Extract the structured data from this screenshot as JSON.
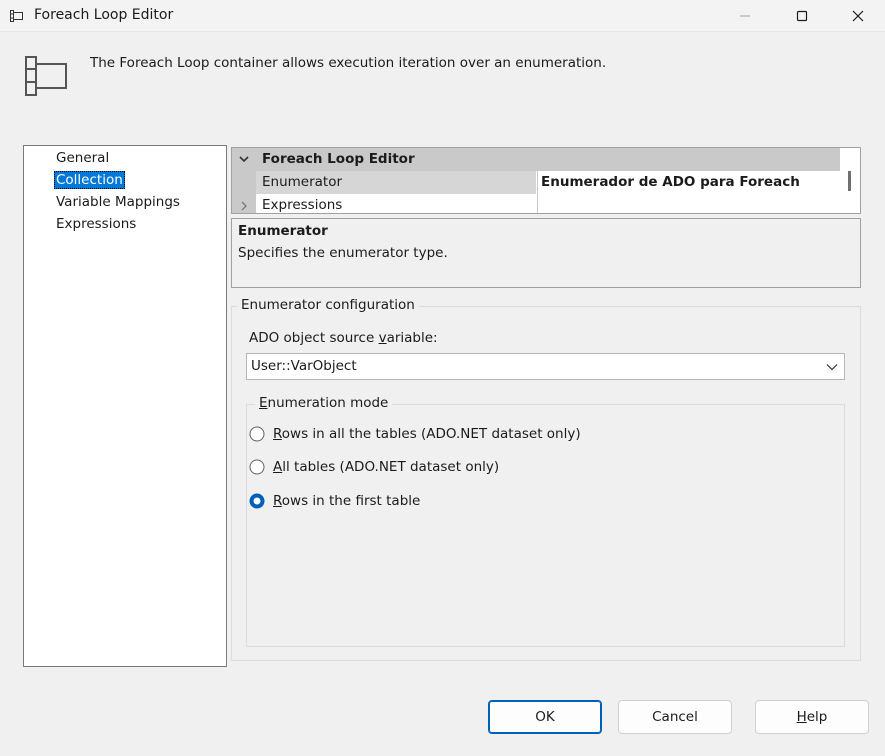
{
  "window": {
    "title": "Foreach Loop Editor",
    "icons": {
      "app": "foreach-container-icon",
      "minimize": "minimize-icon",
      "maximize": "maximize-icon",
      "close": "close-icon"
    }
  },
  "banner": {
    "description": "The Foreach Loop container allows execution iteration over an enumeration."
  },
  "nav": {
    "items": [
      {
        "label": "General"
      },
      {
        "label": "Collection"
      },
      {
        "label": "Variable Mappings"
      },
      {
        "label": "Expressions"
      }
    ],
    "selected": "Collection"
  },
  "property_grid": {
    "category": "Foreach Loop Editor",
    "rows": [
      {
        "name": "Enumerator",
        "value": "Enumerador de ADO para Foreach"
      },
      {
        "name": "Expressions",
        "value": ""
      }
    ]
  },
  "description_panel": {
    "title": "Enumerator",
    "text": "Specifies the enumerator type."
  },
  "enumerator_config": {
    "legend": "Enumerator configuration",
    "source_label_pre": "ADO object source ",
    "source_label_u": "v",
    "source_label_post": "ariable:",
    "source_value": "User::VarObject",
    "mode_group": {
      "legend_u": "E",
      "legend_rest": "numeration mode",
      "options": [
        {
          "u": "R",
          "rest": "ows in all the tables (ADO.NET dataset only)",
          "checked": false
        },
        {
          "u": "A",
          "rest": "ll tables (ADO.NET dataset only)",
          "checked": false
        },
        {
          "u": "R",
          "rest": "ows in the first table",
          "checked": true
        }
      ]
    }
  },
  "buttons": {
    "ok": "OK",
    "cancel": "Cancel",
    "help_u": "H",
    "help_rest": "elp"
  },
  "colors": {
    "accent": "#0078d7",
    "primary_border": "#005fb8"
  }
}
